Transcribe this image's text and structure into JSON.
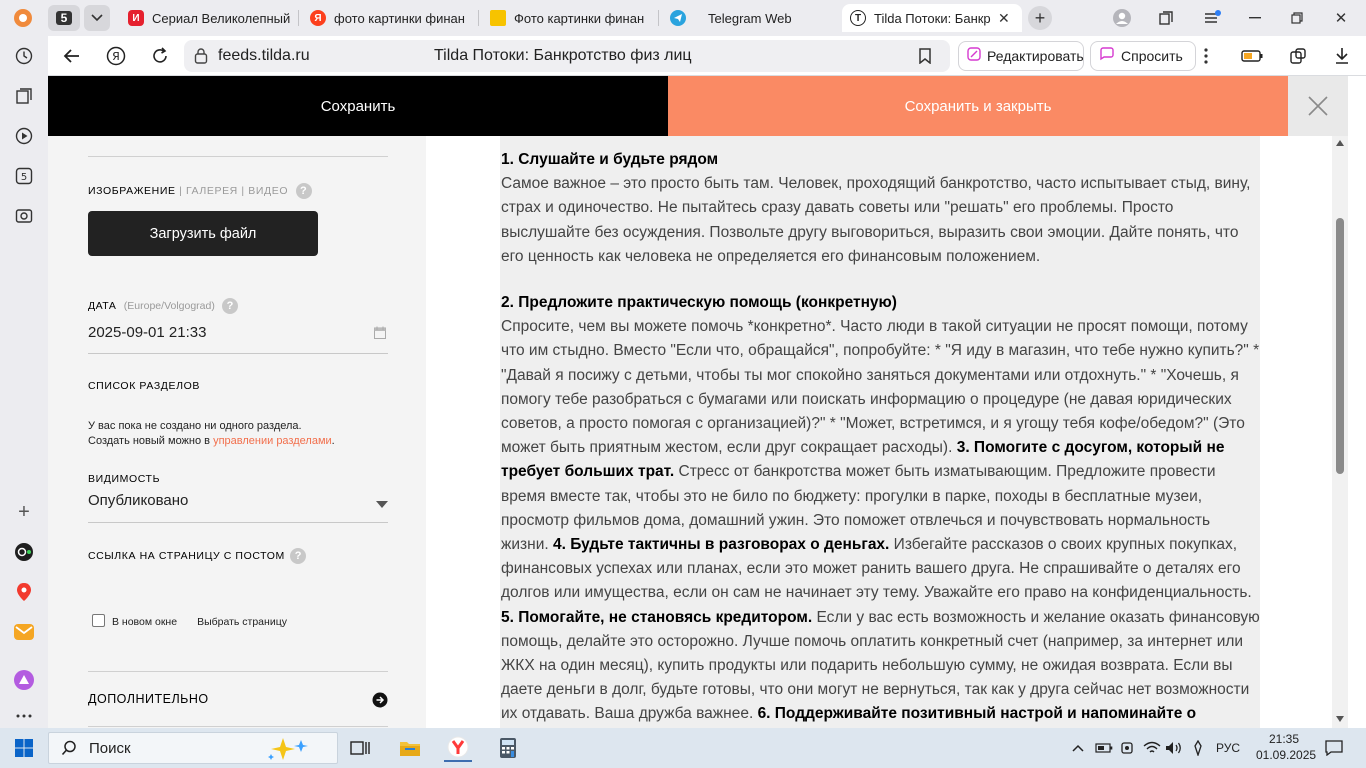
{
  "browser": {
    "tab_counter": "5",
    "tabs": [
      {
        "label": "Сериал Великолепный",
        "fav_text": "И",
        "fav_color": "#e5202e"
      },
      {
        "label": "фото картинки финан",
        "fav_text": "Я",
        "fav_color": "#fc3f1d"
      },
      {
        "label": "Фото картинки финан",
        "fav_text": "",
        "fav_color": "#f7c300"
      },
      {
        "label": "Telegram Web",
        "fav_text": "",
        "fav_color": "#2aa3de"
      },
      {
        "label": "Tilda Потоки: Банкр",
        "fav_text": "T",
        "fav_color": "#222222"
      }
    ],
    "url": "feeds.tilda.ru",
    "page_title": "Tilda Потоки: Банкротство физ лиц",
    "edit_label": "Редактировать",
    "ask_label": "Спросить"
  },
  "tilda": {
    "save_label": "Сохранить",
    "save_close_label": "Сохранить и закрыть"
  },
  "settings": {
    "image_tabs": {
      "image": "ИЗОБРАЖЕНИЕ",
      "gallery": "ГАЛЕРЕЯ",
      "video": "ВИДЕО"
    },
    "upload_label": "Загрузить файл",
    "date_label": "ДАТА",
    "date_tz": "(Europe/Volgograd)",
    "date_value": "2025-09-01 21:33",
    "sections_label": "СПИСОК РАЗДЕЛОВ",
    "sections_empty_1": "У вас пока не создано ни одного раздела.",
    "sections_empty_2": "Создать новый можно в ",
    "sections_link": "управлении разделами",
    "sections_dot": ".",
    "visibility_label": "ВИДИМОСТЬ",
    "visibility_value": "Опубликовано",
    "link_label": "ССЫЛКА НА СТРАНИЦУ С ПОСТОМ",
    "new_window_label": "В новом окне",
    "choose_page_label": "Выбрать страницу",
    "more_label": "ДОПОЛНИТЕЛЬНО",
    "help_mark": "?"
  },
  "editor": {
    "h1": "1. Слушайте и будьте рядом",
    "p1": "Самое важное – это просто быть там. Человек, проходящий банкротство, часто испытывает стыд, вину, страх и одиночество. Не пытайтесь сразу давать советы или \"решать\" его проблемы. Просто выслушайте без осуждения. Позвольте другу выговориться, выразить свои эмоции. Дайте понять, что его ценность как человека не определяется его финансовым положением.",
    "h2": "2. Предложите практическую помощь (конкретную)",
    "p2a": "Спросите, чем вы можете помочь *конкретно*. Часто люди в такой ситуации не просят помощи, потому что им стыдно. Вместо \"Если что, обращайся\", попробуйте: * \"Я иду в магазин, что тебе нужно купить?\" * \"Давай я посижу с детьми, чтобы ты мог спокойно заняться документами или отдохнуть.\" * \"Хочешь, я помогу тебе разобраться с бумагами или поискать информацию о процедуре (не давая юридических советов, а просто помогая с организацией)?\" * \"Может, встретимся, и я угощу тебя кофе/обедом?\" (Это может быть приятным жестом, если друг сокращает расходы). ",
    "h3": "3. Помогите с досугом, который не требует больших трат.",
    "p3": " Стресс от банкротства может быть изматывающим. Предложите провести время вместе так, чтобы это не било по бюджету: прогулки в парке, походы в бесплатные музеи, просмотр фильмов дома, домашний ужин. Это поможет отвлечься и почувствовать нормальность жизни. ",
    "h4": "4. Будьте тактичны в разговорах о деньгах.",
    "p4": " Избегайте рассказов о своих крупных покупках, финансовых успехах или планах, если это может ранить вашего друга. Не спрашивайте о деталях его долгов или имущества, если он сам не начинает эту тему. Уважайте его право на конфиденциальность. ",
    "h5": "5. Помогайте, не становясь кредитором.",
    "p5": " Если у вас есть возможность и желание оказать финансовую помощь, делайте это осторожно. Лучше помочь оплатить конкретный счет (например, за интернет или ЖКХ на один месяц), купить продукты или подарить небольшую сумму, не ожидая возврата. Если вы даете деньги в долг, будьте готовы, что они могут не вернуться, так как у друга сейчас нет возможности их отдавать. Ваша дружба важнее. ",
    "h6": "6. Поддерживайте позитивный настрой и напоминайте о"
  },
  "taskbar": {
    "search_placeholder": "Поиск",
    "lang": "РУС",
    "time": "21:35",
    "date": "01.09.2025"
  }
}
